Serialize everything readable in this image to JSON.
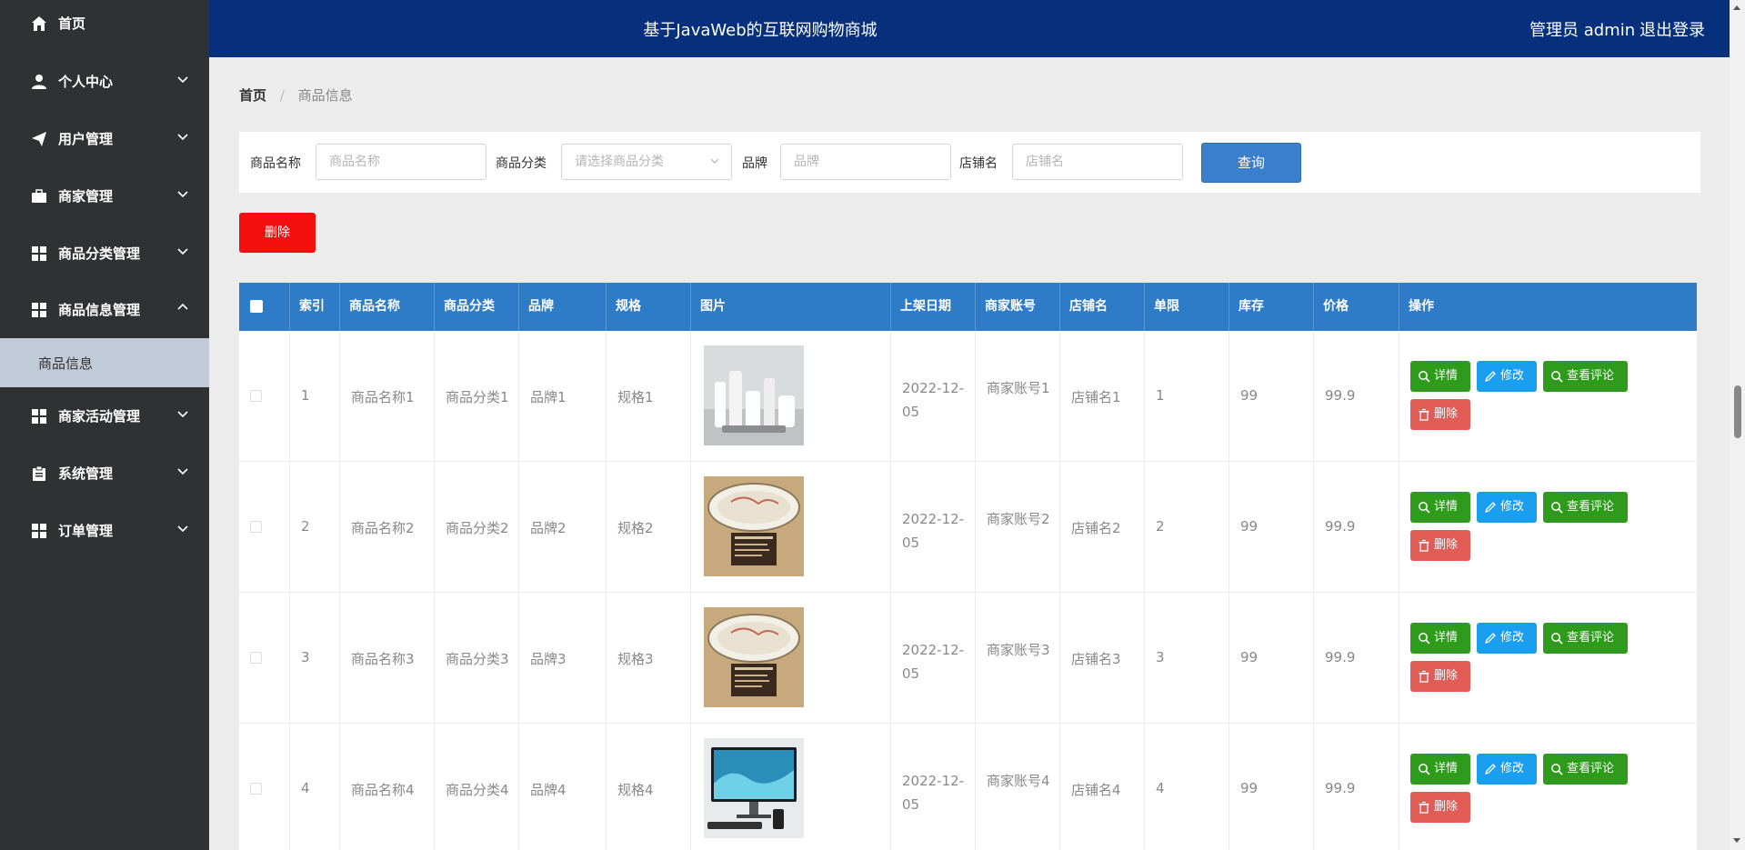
{
  "sidebar": {
    "items": [
      {
        "label": "首页",
        "icon": "home-icon",
        "expanded": null
      },
      {
        "label": "个人中心",
        "icon": "user-icon",
        "expanded": false
      },
      {
        "label": "用户管理",
        "icon": "paper-plane-icon",
        "expanded": false
      },
      {
        "label": "商家管理",
        "icon": "briefcase-icon",
        "expanded": false
      },
      {
        "label": "商品分类管理",
        "icon": "grid-icon",
        "expanded": false
      },
      {
        "label": "商品信息管理",
        "icon": "grid-icon",
        "expanded": true
      },
      {
        "label": "商家活动管理",
        "icon": "grid-icon",
        "expanded": false
      },
      {
        "label": "系统管理",
        "icon": "clipboard-icon",
        "expanded": false
      },
      {
        "label": "订单管理",
        "icon": "grid-icon",
        "expanded": false
      }
    ],
    "active_sub": "商品信息"
  },
  "header": {
    "title": "基于JavaWeb的互联网购物商城",
    "admin": "管理员 admin",
    "logout": "退出登录"
  },
  "breadcrumb": {
    "home": "首页",
    "current": "商品信息"
  },
  "search": {
    "name_label": "商品名称",
    "name_placeholder": "商品名称",
    "category_label": "商品分类",
    "category_placeholder": "请选择商品分类",
    "brand_label": "品牌",
    "brand_placeholder": "品牌",
    "shop_label": "店铺名",
    "shop_placeholder": "店铺名",
    "query_button": "查询"
  },
  "delete_button": "删除",
  "table": {
    "headers": [
      "索引",
      "商品名称",
      "商品分类",
      "品牌",
      "规格",
      "图片",
      "上架日期",
      "商家账号",
      "店铺名",
      "单限",
      "库存",
      "价格",
      "操作"
    ],
    "rows": [
      {
        "index": "1",
        "name": "商品名称1",
        "category": "商品分类1",
        "brand": "品牌1",
        "spec": "规格1",
        "image": "bathroom-accessories",
        "date": "2022-12-05",
        "merchant": "商家账号1",
        "shop": "店铺名1",
        "limit": "1",
        "stock": "99",
        "price": "99.9"
      },
      {
        "index": "2",
        "name": "商品名称2",
        "category": "商品分类2",
        "brand": "品牌2",
        "spec": "规格2",
        "image": "ceiling-lamp",
        "date": "2022-12-05",
        "merchant": "商家账号2",
        "shop": "店铺名2",
        "limit": "2",
        "stock": "99",
        "price": "99.9"
      },
      {
        "index": "3",
        "name": "商品名称3",
        "category": "商品分类3",
        "brand": "品牌3",
        "spec": "规格3",
        "image": "ceiling-lamp",
        "date": "2022-12-05",
        "merchant": "商家账号3",
        "shop": "店铺名3",
        "limit": "3",
        "stock": "99",
        "price": "99.9"
      },
      {
        "index": "4",
        "name": "商品名称4",
        "category": "商品分类4",
        "brand": "品牌4",
        "spec": "规格4",
        "image": "desktop-monitor",
        "date": "2022-12-05",
        "merchant": "商家账号4",
        "shop": "店铺名4",
        "limit": "4",
        "stock": "99",
        "price": "99.9"
      }
    ],
    "actions": {
      "detail": "详情",
      "edit": "修改",
      "reviews": "查看评论",
      "delete": "删除"
    }
  },
  "colors": {
    "sidebar": "#303133",
    "header": "#062f7c",
    "table_header": "#2e7bc8",
    "query_button": "#3a7fcc",
    "delete_top": "#f40f0f",
    "btn_green": "#2f9b1d",
    "btn_blue": "#1a9ff0",
    "btn_red": "#e15c55"
  }
}
